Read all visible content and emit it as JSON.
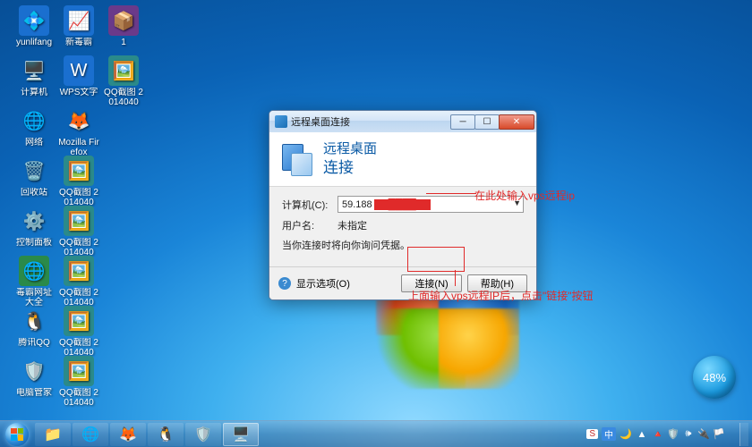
{
  "desktop_icons": [
    {
      "col": 0,
      "row": 0,
      "label": "yunlifang",
      "glyph": "💠",
      "bg": "#1a6fcf"
    },
    {
      "col": 1,
      "row": 0,
      "label": "新毒霸",
      "glyph": "📈",
      "bg": "#1a6fcf"
    },
    {
      "col": 2,
      "row": 0,
      "label": "1",
      "glyph": "📦",
      "bg": "#6a3a8a"
    },
    {
      "col": 0,
      "row": 1,
      "label": "计算机",
      "glyph": "🖥️",
      "bg": "transparent"
    },
    {
      "col": 1,
      "row": 1,
      "label": "WPS文字",
      "glyph": "W",
      "bg": "#1a6fcf"
    },
    {
      "col": 2,
      "row": 1,
      "label": "QQ截图\n20140401…",
      "glyph": "🖼️",
      "bg": "#2a8a8a"
    },
    {
      "col": 0,
      "row": 2,
      "label": "网络",
      "glyph": "🌐",
      "bg": "transparent"
    },
    {
      "col": 1,
      "row": 2,
      "label": "Mozilla Firefox",
      "glyph": "🦊",
      "bg": "transparent"
    },
    {
      "col": 0,
      "row": 3,
      "label": "回收站",
      "glyph": "🗑️",
      "bg": "transparent"
    },
    {
      "col": 1,
      "row": 3,
      "label": "QQ截图\n20140401…",
      "glyph": "🖼️",
      "bg": "#2a8a8a"
    },
    {
      "col": 0,
      "row": 4,
      "label": "控制面板",
      "glyph": "⚙️",
      "bg": "transparent"
    },
    {
      "col": 1,
      "row": 4,
      "label": "QQ截图\n20140401…",
      "glyph": "🖼️",
      "bg": "#2a8a8a"
    },
    {
      "col": 0,
      "row": 5,
      "label": "毒霸网址大全",
      "glyph": "🌐",
      "bg": "#2a8a4a"
    },
    {
      "col": 1,
      "row": 5,
      "label": "QQ截图\n20140401…",
      "glyph": "🖼️",
      "bg": "#2a8a8a"
    },
    {
      "col": 0,
      "row": 6,
      "label": "腾讯QQ",
      "glyph": "🐧",
      "bg": "transparent"
    },
    {
      "col": 1,
      "row": 6,
      "label": "QQ截图\n20140401…",
      "glyph": "🖼️",
      "bg": "#2a8a8a"
    },
    {
      "col": 0,
      "row": 7,
      "label": "电脑管家",
      "glyph": "🛡️",
      "bg": "transparent"
    },
    {
      "col": 1,
      "row": 7,
      "label": "QQ截图\n20140401…",
      "glyph": "🖼️",
      "bg": "#2a8a8a"
    }
  ],
  "dialog": {
    "title": "远程桌面连接",
    "header_line1": "远程桌面",
    "header_line2": "连接",
    "computer_label": "计算机(C):",
    "computer_value": "59.188",
    "user_label": "用户名:",
    "user_value": "未指定",
    "cred_note": "当你连接时将向你询问凭据。",
    "show_options": "显示选项(O)",
    "connect_btn": "连接(N)",
    "help_btn": "帮助(H)"
  },
  "annotations": {
    "input_note": "在此处输入vps远程ip",
    "connect_note": "上面输入vps远程IP后，点击\"链接\"按钮"
  },
  "badge": "48%",
  "taskbar_buttons": [
    {
      "name": "explorer",
      "glyph": "📁",
      "bg": "#f0c060"
    },
    {
      "name": "chrome",
      "glyph": "🌐",
      "bg": "#e04a3a"
    },
    {
      "name": "firefox",
      "glyph": "🦊",
      "bg": "#f07a1a"
    },
    {
      "name": "qq",
      "glyph": "🐧",
      "bg": "#3a9ae0"
    },
    {
      "name": "guanjia",
      "glyph": "🛡️",
      "bg": "#2a8a4a"
    },
    {
      "name": "rdp",
      "glyph": "🖥️",
      "bg": "#4a9ae0",
      "active": true
    }
  ],
  "tray": {
    "ime1": "S",
    "ime2": "中",
    "ime3": "🌙",
    "icons": [
      "🔺",
      "🛡️",
      "🕪",
      "🔌",
      "🏳️"
    ],
    "clock_time": "",
    "clock_date": ""
  }
}
